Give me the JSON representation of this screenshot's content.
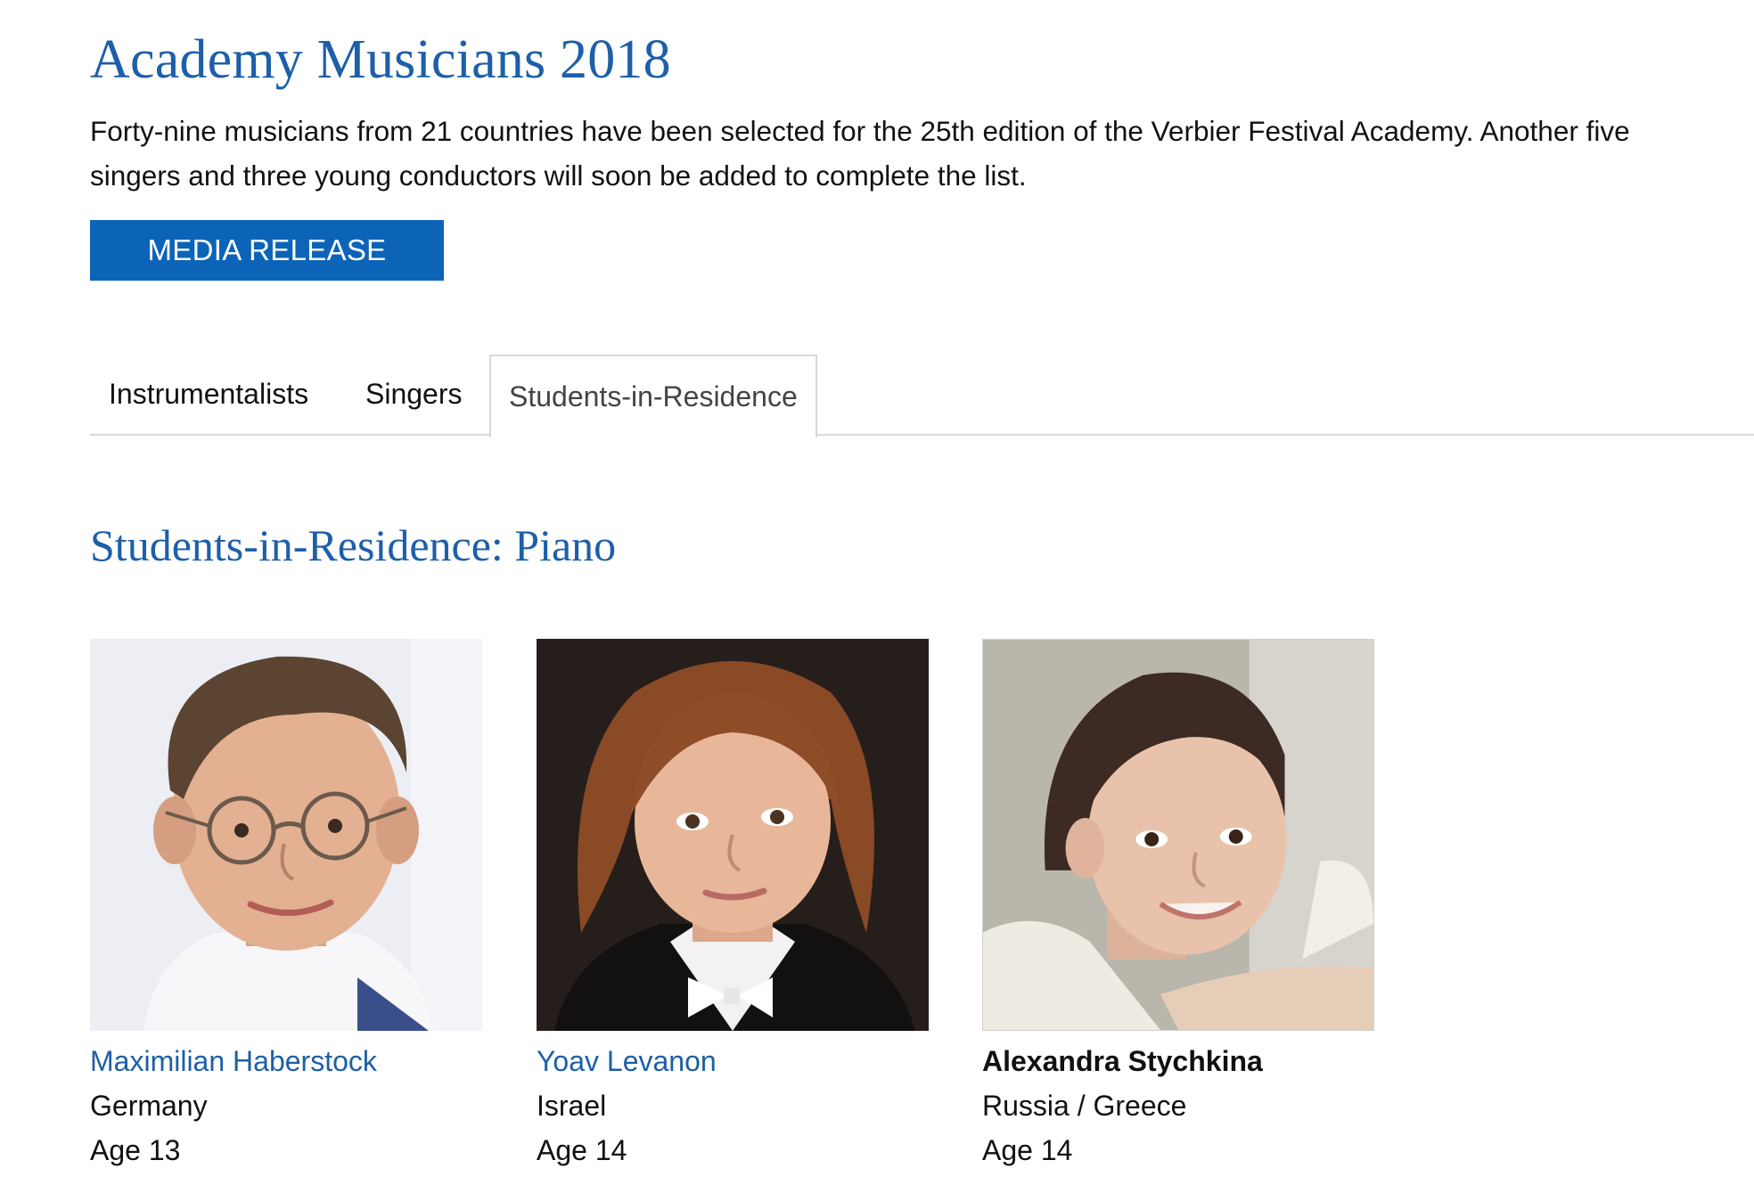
{
  "header": {
    "title": "Academy Musicians 2018",
    "intro_line1": "Forty-nine musicians from 21 countries have been selected for the 25th edition of the Verbier Festival Academy. Another five",
    "intro_line2": "singers and three young conductors will soon be added to complete the list.",
    "media_button": "MEDIA RELEASE"
  },
  "tabs": [
    {
      "label": "Instrumentalists",
      "active": false
    },
    {
      "label": "Singers",
      "active": false
    },
    {
      "label": "Students-in-Residence",
      "active": true
    }
  ],
  "section": {
    "title": "Students-in-Residence: Piano"
  },
  "musicians": [
    {
      "name": "Maximilian Haberstock",
      "country": "Germany",
      "age": "Age 13",
      "photo_icon": "portrait-boy-glasses"
    },
    {
      "name": "Yoav Levanon",
      "country": "Israel",
      "age": "Age 14",
      "photo_icon": "portrait-boy-bowtie"
    },
    {
      "name": "Alexandra Stychkina",
      "country": "Russia / Greece",
      "age": "Age 14",
      "photo_icon": "portrait-girl"
    }
  ],
  "colors": {
    "accent": "#1d5fa8",
    "button": "#0c64b8"
  }
}
